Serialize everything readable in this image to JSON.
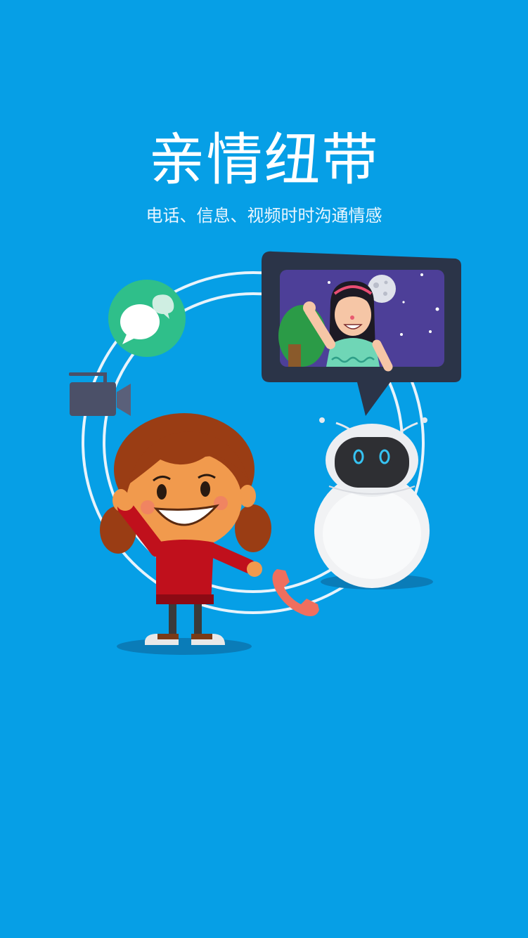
{
  "screen": {
    "title": "亲情纽带",
    "subtitle": "电话、信息、视频时时沟通情感"
  },
  "illustration": {
    "icons": [
      "chat-bubble-icon",
      "video-camera-icon",
      "phone-handset-icon"
    ],
    "figures": [
      "girl-figure",
      "robot-figure",
      "video-call-bubble"
    ]
  },
  "colors": {
    "background": "#069fe6",
    "chat_green": "#2fbf8a",
    "camera_gray": "#4b5068",
    "phone_coral": "#ef6f5e",
    "shirt_red": "#c0101c"
  }
}
